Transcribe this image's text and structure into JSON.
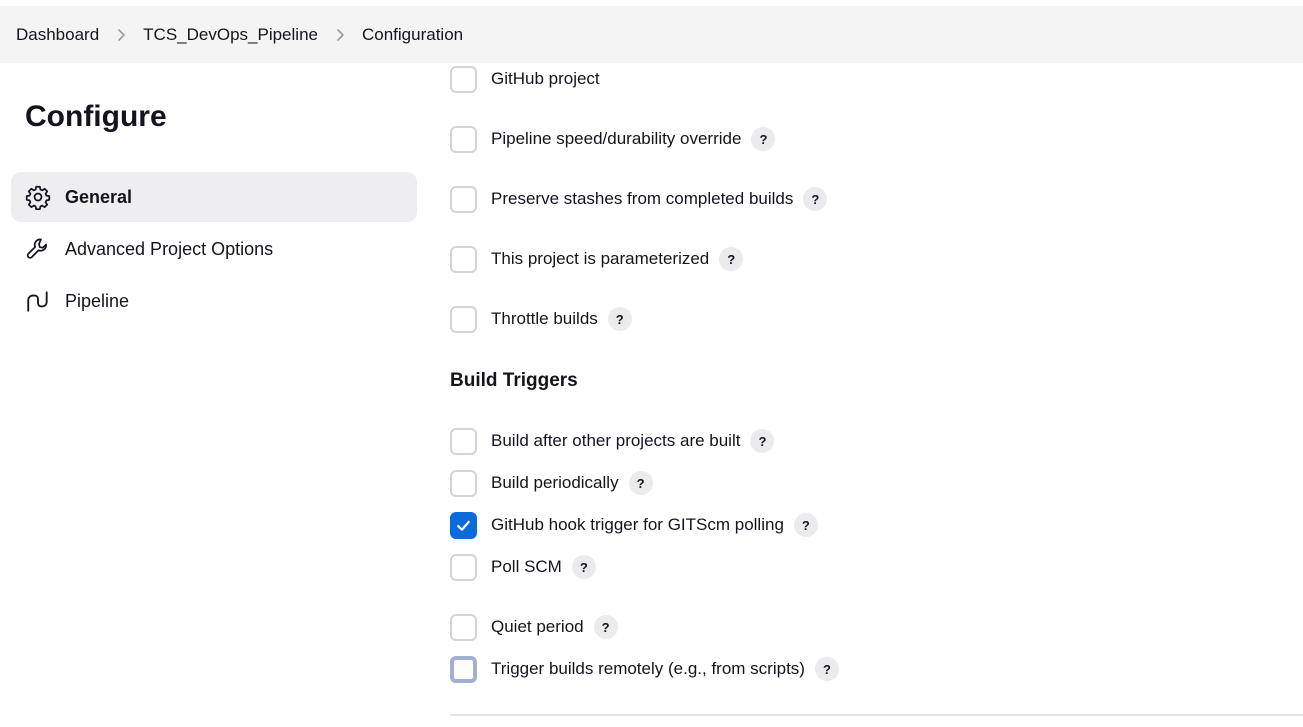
{
  "breadcrumb": {
    "items": [
      {
        "label": "Dashboard"
      },
      {
        "label": "TCS_DevOps_Pipeline"
      },
      {
        "label": "Configuration"
      }
    ]
  },
  "sidebar": {
    "title": "Configure",
    "items": [
      {
        "label": "General",
        "icon": "gear-icon",
        "active": true
      },
      {
        "label": "Advanced Project Options",
        "icon": "wrench-icon",
        "active": false
      },
      {
        "label": "Pipeline",
        "icon": "pipeline-icon",
        "active": false
      }
    ]
  },
  "general_options": [
    {
      "label": "GitHub project",
      "checked": false,
      "help": false
    },
    {
      "label": "Pipeline speed/durability override",
      "checked": false,
      "help": true
    },
    {
      "label": "Preserve stashes from completed builds",
      "checked": false,
      "help": true
    },
    {
      "label": "This project is parameterized",
      "checked": false,
      "help": true
    },
    {
      "label": "Throttle builds",
      "checked": false,
      "help": true
    }
  ],
  "build_triggers": {
    "heading": "Build Triggers",
    "options": [
      {
        "label": "Build after other projects are built",
        "checked": false,
        "help": true
      },
      {
        "label": "Build periodically",
        "checked": false,
        "help": true
      },
      {
        "label": "GitHub hook trigger for GITScm polling",
        "checked": true,
        "help": true
      },
      {
        "label": "Poll SCM",
        "checked": false,
        "help": true
      },
      {
        "label": "Quiet period",
        "checked": false,
        "help": true
      },
      {
        "label": "Trigger builds remotely (e.g., from scripts)",
        "checked": false,
        "focused": true,
        "help": true
      }
    ]
  },
  "help_symbol": "?",
  "colors": {
    "accent": "#0b6bdb",
    "breadcrumb_bg": "#f4f4f5",
    "active_nav_bg": "#eeeef0"
  }
}
